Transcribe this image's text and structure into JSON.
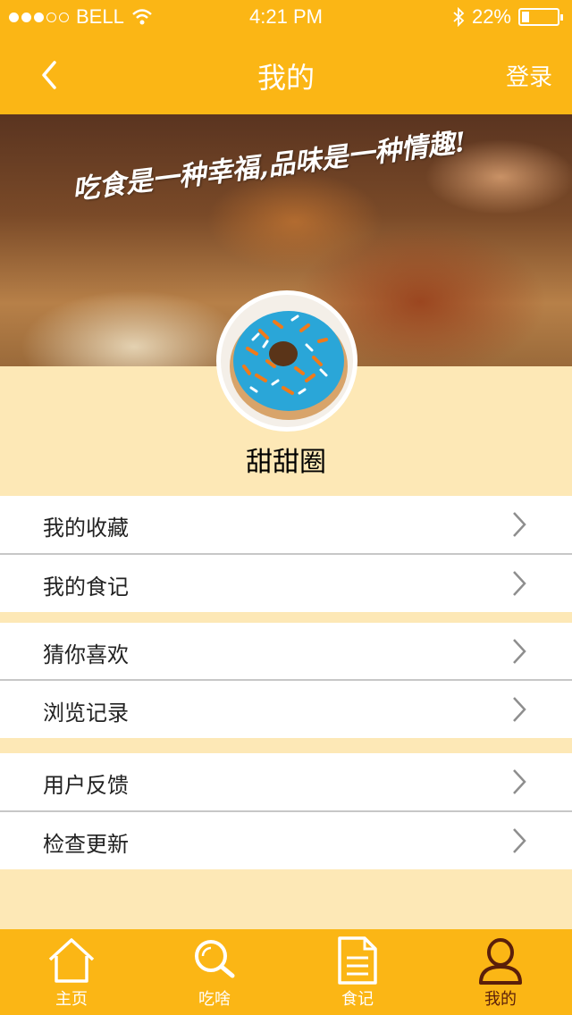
{
  "status_bar": {
    "carrier": "BELL",
    "time": "4:21 PM",
    "battery": "22%",
    "battery_level": 0.22
  },
  "nav": {
    "title": "我的",
    "login": "登录"
  },
  "banner": {
    "slogan": "吃食是一种幸福,品味是一种情趣!"
  },
  "profile": {
    "name": "甜甜圈"
  },
  "menu": [
    {
      "label": "我的收藏"
    },
    {
      "label": "我的食记"
    },
    {
      "label": "猜你喜欢"
    },
    {
      "label": "浏览记录"
    },
    {
      "label": "用户反馈"
    },
    {
      "label": "检查更新"
    }
  ],
  "tabs": [
    {
      "label": "主页",
      "icon": "home-icon"
    },
    {
      "label": "吃啥",
      "icon": "search-icon"
    },
    {
      "label": "食记",
      "icon": "document-icon"
    },
    {
      "label": "我的",
      "icon": "person-icon",
      "active": true
    }
  ],
  "colors": {
    "primary": "#fbb615",
    "background": "#fde8b6",
    "active_tab": "#5a1f0a"
  }
}
